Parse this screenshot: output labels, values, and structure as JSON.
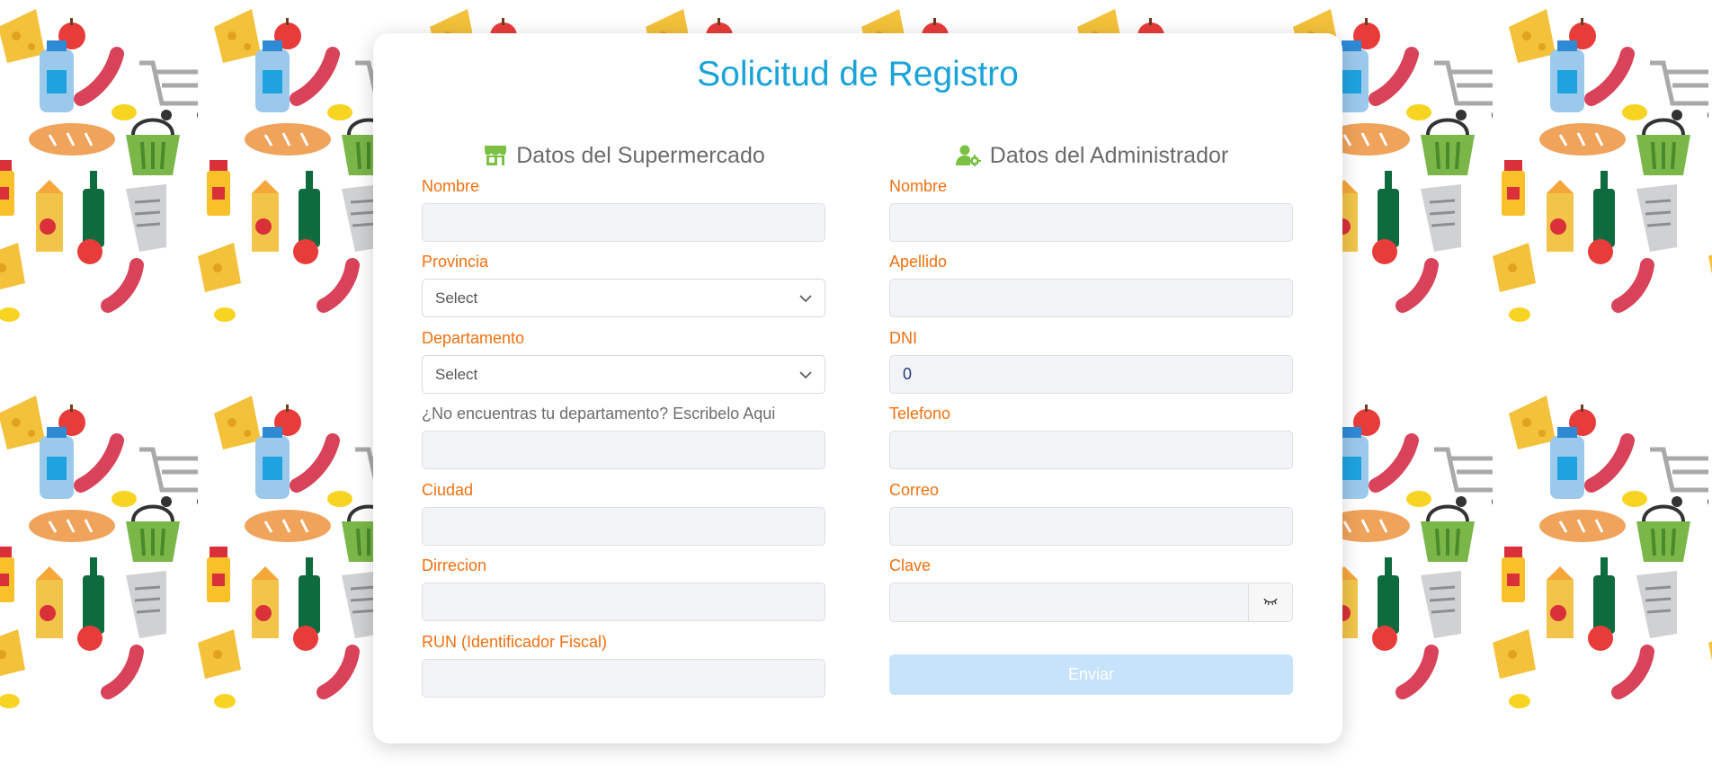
{
  "form": {
    "title": "Solicitud de Registro",
    "submit_label": "Enviar",
    "submit_state": "disabled"
  },
  "supermarket": {
    "heading": "Datos del Supermercado",
    "heading_icon": "store-icon",
    "nombre_label": "Nombre",
    "nombre_value": "",
    "provincia_label": "Provincia",
    "provincia_value": "Select",
    "departamento_label": "Departamento",
    "departamento_value": "Select",
    "otro_departamento_label": "¿No encuentras tu departamento? Escribelo Aqui",
    "otro_departamento_value": "",
    "ciudad_label": "Ciudad",
    "ciudad_value": "",
    "direccion_label": "Dirrecion",
    "direccion_value": "",
    "run_label": "RUN (Identificador Fiscal)",
    "run_value": ""
  },
  "admin": {
    "heading": "Datos del Administrador",
    "heading_icon": "user-cog-icon",
    "nombre_label": "Nombre",
    "nombre_value": "",
    "apellido_label": "Apellido",
    "apellido_value": "",
    "dni_label": "DNI",
    "dni_value": "0",
    "telefono_label": "Telefono",
    "telefono_value": "",
    "correo_label": "Correo",
    "correo_value": "",
    "clave_label": "Clave",
    "clave_value": "",
    "toggle_icon": "eye-closed-icon"
  },
  "colors": {
    "title": "#1aa3d9",
    "label": "#f2700f",
    "icon_green": "#7ac143",
    "submit_bg": "#c7e3fc"
  },
  "background": {
    "pattern": "grocery-items",
    "icons": [
      "bread-icon",
      "basket-icon",
      "mustard-bottle-icon",
      "juice-box-icon",
      "wine-bottle-icon",
      "receipt-icon",
      "cheese-icon",
      "apple-icon",
      "water-bottle-icon",
      "sausage-icon",
      "shopping-cart-icon",
      "lemon-icon"
    ]
  }
}
